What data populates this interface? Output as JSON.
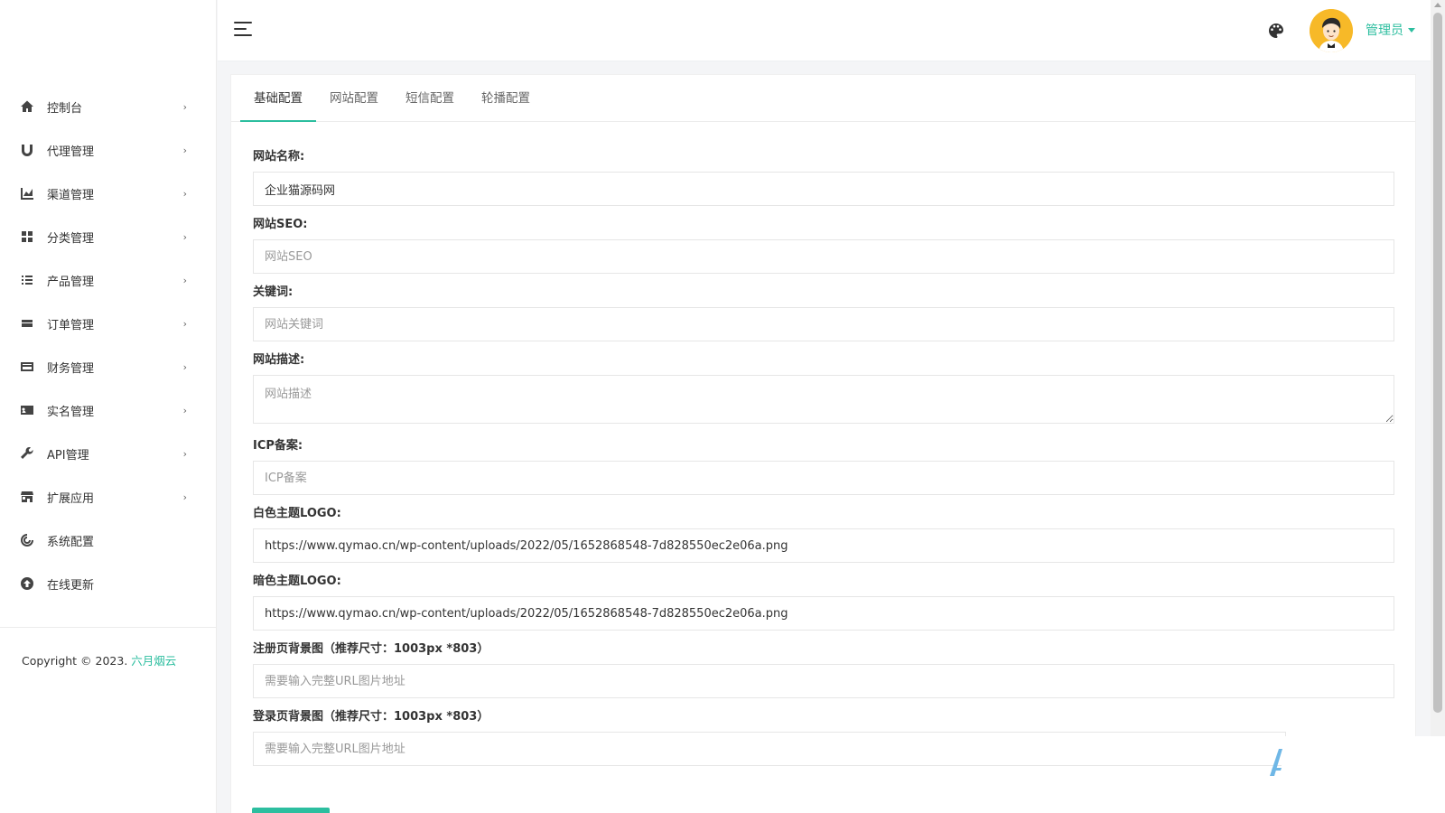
{
  "sidebar": {
    "items": [
      {
        "label": "控制台",
        "icon": "home-icon",
        "arrow": "›"
      },
      {
        "label": "代理管理",
        "icon": "magnet-icon",
        "arrow": "›"
      },
      {
        "label": "渠道管理",
        "icon": "chart-icon",
        "arrow": "›"
      },
      {
        "label": "分类管理",
        "icon": "grid-icon",
        "arrow": "›"
      },
      {
        "label": "产品管理",
        "icon": "list-icon",
        "arrow": "›"
      },
      {
        "label": "订单管理",
        "icon": "order-icon",
        "arrow": "›"
      },
      {
        "label": "财务管理",
        "icon": "card-icon",
        "arrow": "›"
      },
      {
        "label": "实名管理",
        "icon": "id-card-icon",
        "arrow": "›"
      },
      {
        "label": "API管理",
        "icon": "wrench-icon",
        "arrow": "›"
      },
      {
        "label": "扩展应用",
        "icon": "store-icon",
        "arrow": "›"
      },
      {
        "label": "系统配置",
        "icon": "settings-icon"
      },
      {
        "label": "在线更新",
        "icon": "upload-icon"
      }
    ],
    "copyright_prefix": "Copyright © 2023.",
    "copyright_link": "六月烟云"
  },
  "topbar": {
    "user_label": "管理员"
  },
  "tabs": [
    "基础配置",
    "网站配置",
    "短信配置",
    "轮播配置"
  ],
  "form": {
    "site_name": {
      "label": "网站名称:",
      "value": "企业猫源码网",
      "placeholder": ""
    },
    "site_seo": {
      "label": "网站SEO:",
      "value": "",
      "placeholder": "网站SEO"
    },
    "keywords": {
      "label": "关键词:",
      "value": "",
      "placeholder": "网站关键词"
    },
    "description": {
      "label": "网站描述:",
      "value": "",
      "placeholder": "网站描述"
    },
    "icp": {
      "label": "ICP备案:",
      "value": "",
      "placeholder": "ICP备案"
    },
    "light_logo": {
      "label": "白色主题LOGO:",
      "value": "https://www.qymao.cn/wp-content/uploads/2022/05/1652868548-7d828550ec2e06a.png",
      "placeholder": ""
    },
    "dark_logo": {
      "label": "暗色主题LOGO:",
      "value": "https://www.qymao.cn/wp-content/uploads/2022/05/1652868548-7d828550ec2e06a.png",
      "placeholder": ""
    },
    "register_bg": {
      "label": "注册页背景图（推荐尺寸：1003px *803）",
      "value": "",
      "placeholder": "需要输入完整URL图片地址"
    },
    "login_bg": {
      "label": "登录页背景图（推荐尺寸：1003px *803）",
      "value": "",
      "placeholder": "需要输入完整URL图片地址"
    }
  },
  "colors": {
    "accent": "#2cbe9f",
    "avatar_bg": "#f7b928"
  }
}
